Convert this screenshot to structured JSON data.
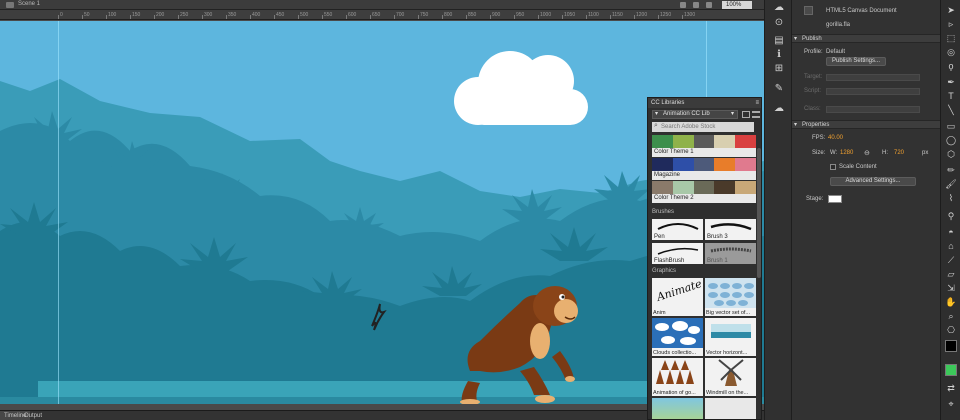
{
  "scene_bar": {
    "scene_label": "Scene 1",
    "zoom": "100%"
  },
  "ruler": {
    "ticks": [
      "0",
      "50",
      "100",
      "150",
      "200",
      "250",
      "300",
      "350",
      "400",
      "450",
      "500",
      "550",
      "600",
      "650",
      "700",
      "750",
      "800",
      "850",
      "900",
      "950",
      "1000",
      "1050",
      "1100",
      "1150",
      "1200",
      "1250",
      "1300"
    ]
  },
  "bottom_tabs": [
    "Timeline",
    "Output"
  ],
  "properties": {
    "doc_type": "HTML5 Canvas Document",
    "file_name": "gorilla.fla",
    "publish_section": "Publish",
    "profile_label": "Profile:",
    "profile_value": "Default",
    "publish_settings_button": "Publish Settings...",
    "target_label": "Target:",
    "script_label": "Script:",
    "class_label": "Class:",
    "properties_section": "Properties",
    "fps_label": "FPS:",
    "fps_value": "40.00",
    "size_label": "Size:",
    "w_label": "W:",
    "w_value": "1280",
    "h_label": "H:",
    "h_value": "720",
    "unit": "px",
    "scale_content": "Scale Content",
    "advanced_settings_button": "Advanced Settings...",
    "stage_label": "Stage:",
    "stage_color": "#ffffff"
  },
  "cc_libraries": {
    "title": "CC Libraries",
    "library_name": "Animation CC Lib",
    "search_placeholder": "Search Adobe Stock",
    "themes": [
      {
        "name": "Color Theme 1",
        "colors": [
          "#3d8f4c",
          "#8fb24a",
          "#5a5a5a",
          "#d8cfb0",
          "#d94040"
        ]
      },
      {
        "name": "Magazine",
        "colors": [
          "#1f2a5c",
          "#2e4fa8",
          "#4d5a7a",
          "#e87d2a",
          "#e07a8e"
        ]
      },
      {
        "name": "Color Theme 2",
        "colors": [
          "#8a7a6a",
          "#a8c8a8",
          "#6a6a58",
          "#4a3a2a",
          "#c8a878"
        ]
      }
    ],
    "brushes_label": "Brushes",
    "brushes": [
      "Pen",
      "Brush 3",
      "FlashBrush",
      "Brush 1"
    ],
    "graphics_label": "Graphics",
    "graphics": [
      "Anim",
      "Big vector set of...",
      "Clouds collectio...",
      "Vector horizont...",
      "Animation of go...",
      "Windmill on the..."
    ],
    "graphic_anim_text": "Animate"
  },
  "colors": {
    "sky": "#5ab4dc",
    "ground": "#2a8aa0",
    "accent_orange": "#f0a030"
  }
}
